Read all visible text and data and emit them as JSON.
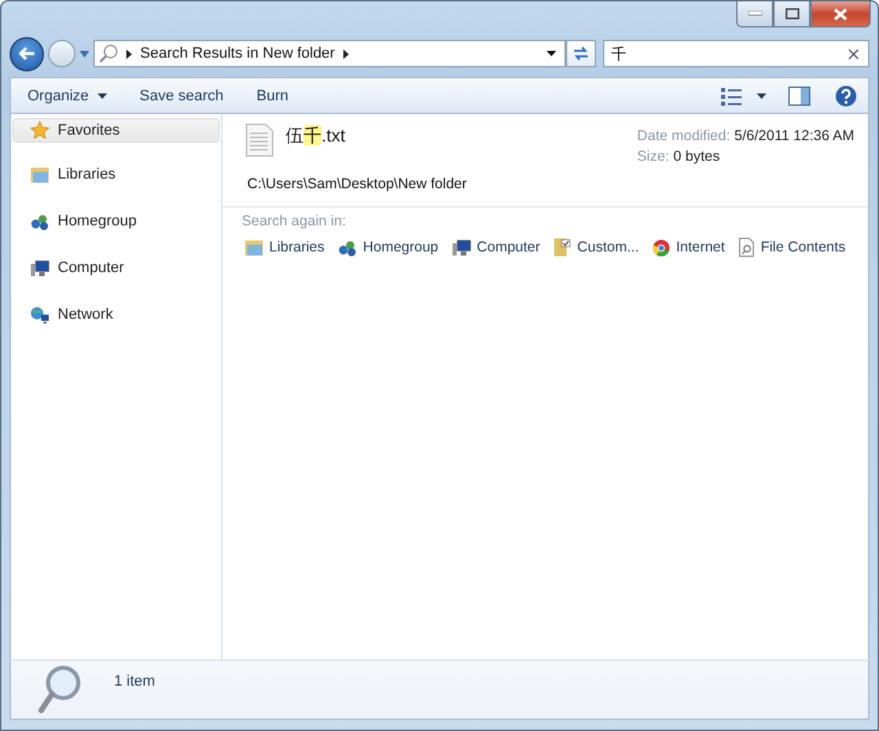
{
  "address_bar": {
    "breadcrumb": "Search Results in New folder"
  },
  "search": {
    "value": "千"
  },
  "toolbar": {
    "buttons": [
      {
        "label": "Organize",
        "dropdown": true
      },
      {
        "label": "Save search",
        "dropdown": false
      },
      {
        "label": "Burn",
        "dropdown": false
      }
    ]
  },
  "sidebar": {
    "items": [
      {
        "label": "Favorites",
        "kind": "star",
        "selected": true
      },
      {
        "label": "Libraries",
        "kind": "library",
        "selected": false
      },
      {
        "label": "Homegroup",
        "kind": "homegroup",
        "selected": false
      },
      {
        "label": "Computer",
        "kind": "computer",
        "selected": false
      },
      {
        "label": "Network",
        "kind": "network",
        "selected": false
      }
    ]
  },
  "result": {
    "name_parts": [
      {
        "text": "伍",
        "highlighted": false
      },
      {
        "text": "千",
        "highlighted": true
      },
      {
        "text": ".txt",
        "highlighted": false
      }
    ],
    "path": "C:\\Users\\Sam\\Desktop\\New folder",
    "date_label": "Date modified:",
    "date_value": "5/6/2011 12:36 AM",
    "size_label": "Size:",
    "size_value": "0 bytes"
  },
  "search_again": {
    "heading": "Search again in:",
    "items": [
      {
        "label": "Libraries",
        "kind": "library"
      },
      {
        "label": "Homegroup",
        "kind": "homegroup"
      },
      {
        "label": "Computer",
        "kind": "computer"
      },
      {
        "label": "Custom...",
        "kind": "custom"
      },
      {
        "label": "Internet",
        "kind": "internet"
      },
      {
        "label": "File Contents",
        "kind": "file"
      }
    ]
  },
  "status_bar": {
    "text": "1 item"
  }
}
